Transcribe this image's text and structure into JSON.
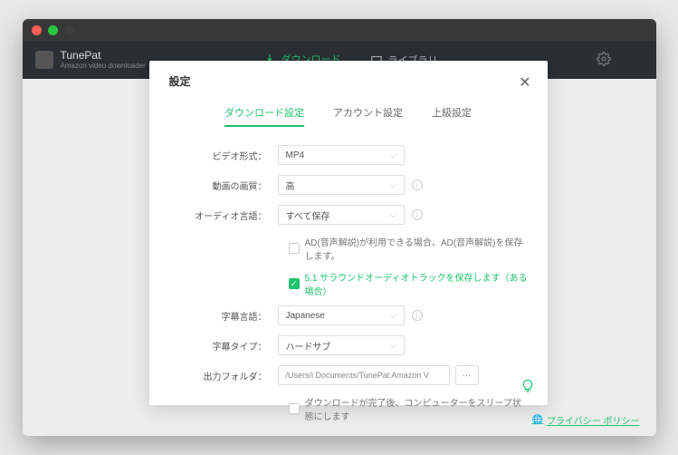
{
  "brand": {
    "name": "TunePat",
    "subtitle": "Amazon video downloader"
  },
  "nav": {
    "download": "ダウンロード",
    "library": "ライブラリ"
  },
  "privacy": "プライバシー ポリシー",
  "modal": {
    "title": "設定",
    "tabs": {
      "download": "ダウンロード設定",
      "account": "アカウント設定",
      "advanced": "上級設定"
    },
    "labels": {
      "video_format": "ビデオ形式：",
      "video_quality": "動画の画質：",
      "audio_language": "オーディオ言語：",
      "subtitle_language": "字幕言語：",
      "subtitle_type": "字幕タイプ：",
      "output_folder": "出力フォルダ："
    },
    "values": {
      "video_format": "MP4",
      "video_quality": "高",
      "audio_language": "すべて保存",
      "subtitle_language": "Japanese",
      "subtitle_type": "ハードサブ",
      "output_folder": "/Users/i         Documents/TunePat Amazon V"
    },
    "checks": {
      "ad": "AD(音声解説)が利用できる場合、AD(音声解説)を保存します。",
      "surround": "5.1 サラウンドオーディオトラックを保存します（ある場合）",
      "sleep": "ダウンロードが完了後、コンピューターをスリープ状態にします"
    }
  }
}
